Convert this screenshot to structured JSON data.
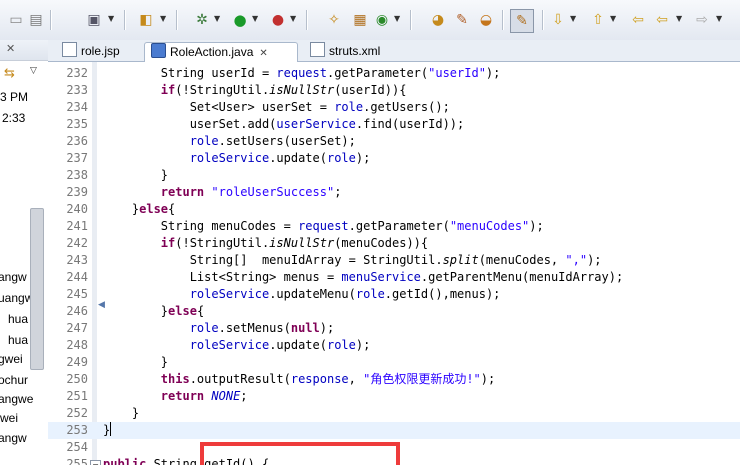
{
  "left_panel": {
    "time": "3 PM",
    "clock": "2:33",
    "fragments": [
      "angw",
      "uangw",
      "hua",
      "hua",
      "gwei",
      "ochur",
      "angwe",
      "wei",
      "angw"
    ]
  },
  "tabs": [
    {
      "label": "role.jsp",
      "active": false,
      "icon": "jsp-file-icon"
    },
    {
      "label": "RoleAction.java",
      "active": true,
      "icon": "java-file-icon",
      "close": "✕"
    },
    {
      "label": "struts.xml",
      "active": false,
      "icon": "xml-file-icon"
    }
  ],
  "code": {
    "lines": [
      {
        "n": "232",
        "tokens": [
          {
            "t": "        String userId = "
          },
          {
            "t": "request",
            "c": "fld"
          },
          {
            "t": ".getParameter("
          },
          {
            "t": "\"userId\"",
            "c": "str"
          },
          {
            "t": ");"
          }
        ]
      },
      {
        "n": "233",
        "tokens": [
          {
            "t": "        "
          },
          {
            "t": "if",
            "c": "kw"
          },
          {
            "t": "(!StringUtil."
          },
          {
            "t": "isNullStr",
            "c": "ital"
          },
          {
            "t": "(userId)){"
          }
        ]
      },
      {
        "n": "234",
        "tokens": [
          {
            "t": "            Set<User> userSet = "
          },
          {
            "t": "role",
            "c": "fld"
          },
          {
            "t": ".getUsers();"
          }
        ]
      },
      {
        "n": "235",
        "tokens": [
          {
            "t": "            userSet.add("
          },
          {
            "t": "userService",
            "c": "fld"
          },
          {
            "t": ".find(userId));"
          }
        ]
      },
      {
        "n": "236",
        "tokens": [
          {
            "t": "            "
          },
          {
            "t": "role",
            "c": "fld"
          },
          {
            "t": ".setUsers(userSet);"
          }
        ]
      },
      {
        "n": "237",
        "tokens": [
          {
            "t": "            "
          },
          {
            "t": "roleService",
            "c": "fld"
          },
          {
            "t": ".update("
          },
          {
            "t": "role",
            "c": "fld"
          },
          {
            "t": ");"
          }
        ]
      },
      {
        "n": "238",
        "tokens": [
          {
            "t": "        }"
          }
        ]
      },
      {
        "n": "239",
        "tokens": [
          {
            "t": "        "
          },
          {
            "t": "return",
            "c": "kw"
          },
          {
            "t": " "
          },
          {
            "t": "\"roleUserSuccess\"",
            "c": "str"
          },
          {
            "t": ";"
          }
        ]
      },
      {
        "n": "240",
        "tokens": [
          {
            "t": "    }"
          },
          {
            "t": "else",
            "c": "kw"
          },
          {
            "t": "{"
          }
        ]
      },
      {
        "n": "241",
        "tokens": [
          {
            "t": "        String menuCodes = "
          },
          {
            "t": "request",
            "c": "fld"
          },
          {
            "t": ".getParameter("
          },
          {
            "t": "\"menuCodes\"",
            "c": "str"
          },
          {
            "t": ");"
          }
        ]
      },
      {
        "n": "242",
        "tokens": [
          {
            "t": "        "
          },
          {
            "t": "if",
            "c": "kw"
          },
          {
            "t": "(!StringUtil."
          },
          {
            "t": "isNullStr",
            "c": "ital"
          },
          {
            "t": "(menuCodes)){"
          }
        ]
      },
      {
        "n": "243",
        "tokens": [
          {
            "t": "            String[]  menuIdArray = StringUtil."
          },
          {
            "t": "split",
            "c": "ital"
          },
          {
            "t": "(menuCodes, "
          },
          {
            "t": "\",\"",
            "c": "str"
          },
          {
            "t": ");"
          }
        ]
      },
      {
        "n": "244",
        "tokens": [
          {
            "t": "            List<String> menus = "
          },
          {
            "t": "menuService",
            "c": "fld"
          },
          {
            "t": ".getParentMenu(menuIdArray);"
          }
        ]
      },
      {
        "n": "245",
        "tokens": [
          {
            "t": "            "
          },
          {
            "t": "roleService",
            "c": "fld"
          },
          {
            "t": ".updateMenu("
          },
          {
            "t": "role",
            "c": "fld"
          },
          {
            "t": ".getId(),menus);"
          }
        ]
      },
      {
        "n": "246",
        "tokens": [
          {
            "t": "        }"
          },
          {
            "t": "else",
            "c": "kw"
          },
          {
            "t": "{"
          }
        ]
      },
      {
        "n": "247",
        "tokens": [
          {
            "t": "            "
          },
          {
            "t": "role",
            "c": "fld"
          },
          {
            "t": ".setMenus("
          },
          {
            "t": "null",
            "c": "kw"
          },
          {
            "t": ");"
          }
        ]
      },
      {
        "n": "248",
        "tokens": [
          {
            "t": "            "
          },
          {
            "t": "roleService",
            "c": "fld"
          },
          {
            "t": ".update("
          },
          {
            "t": "role",
            "c": "fld"
          },
          {
            "t": ");"
          }
        ]
      },
      {
        "n": "249",
        "tokens": [
          {
            "t": "        }"
          }
        ]
      },
      {
        "n": "250",
        "tokens": [
          {
            "t": "        "
          },
          {
            "t": "this",
            "c": "kw"
          },
          {
            "t": ".outputResult("
          },
          {
            "t": "response",
            "c": "fld"
          },
          {
            "t": ", "
          },
          {
            "t": "\"角色权限更新成功!\"",
            "c": "str"
          },
          {
            "t": ");"
          }
        ]
      },
      {
        "n": "251",
        "tokens": [
          {
            "t": "        "
          },
          {
            "t": "return",
            "c": "kw"
          },
          {
            "t": " "
          },
          {
            "t": "NONE",
            "c": "constf"
          },
          {
            "t": ";"
          }
        ]
      },
      {
        "n": "252",
        "tokens": [
          {
            "t": "    }"
          }
        ]
      },
      {
        "n": "253",
        "tokens": [
          {
            "t": "}"
          }
        ],
        "current": true,
        "caret": true
      },
      {
        "n": "254",
        "tokens": [
          {
            "t": ""
          }
        ]
      },
      {
        "n": "255",
        "tokens": [
          {
            "t": "public",
            "c": "kw"
          },
          {
            "t": " String getId() {"
          }
        ]
      }
    ]
  }
}
